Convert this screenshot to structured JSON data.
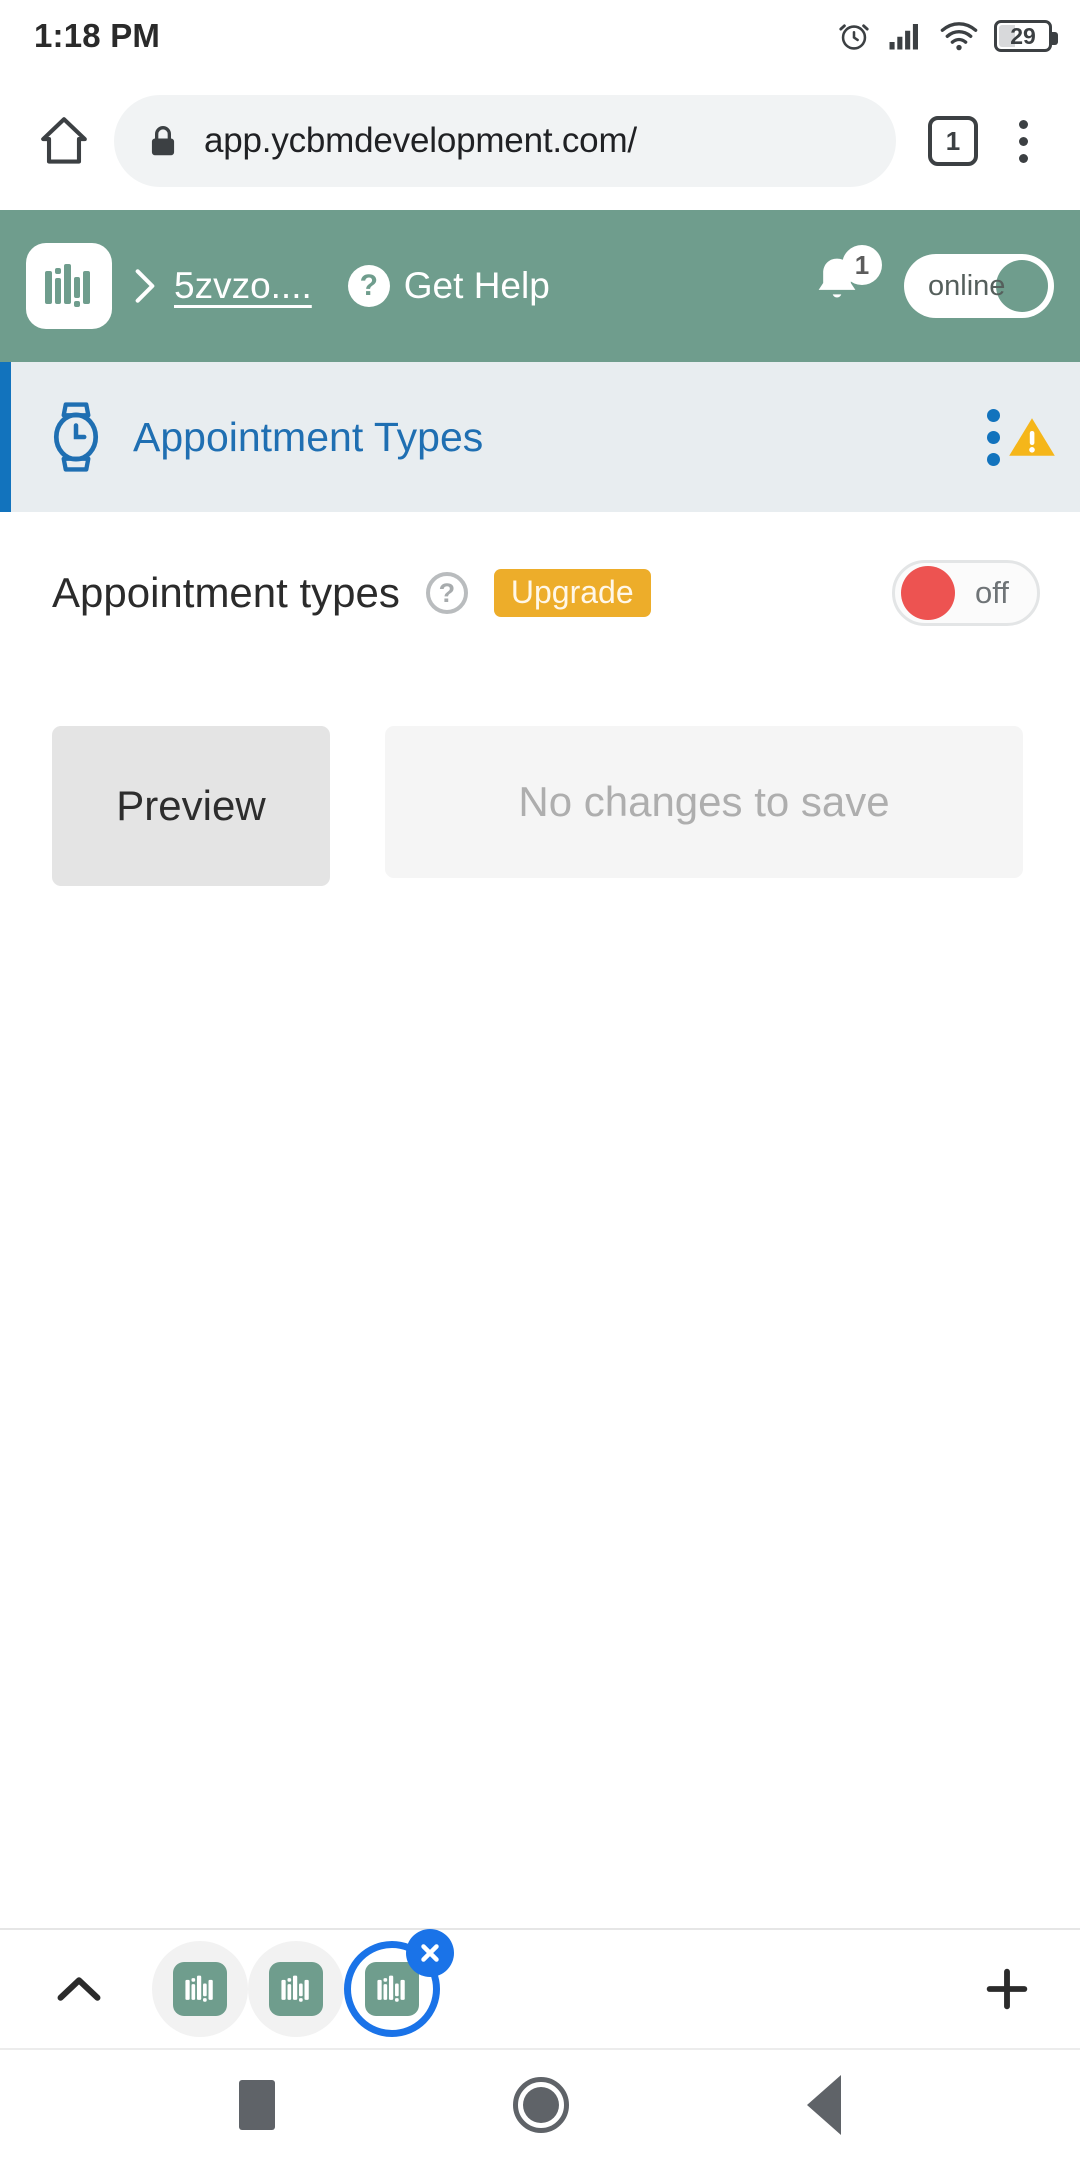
{
  "status_bar": {
    "time": "1:18 PM",
    "battery_percent": "29",
    "icons": [
      "alarm-icon",
      "signal-icon",
      "wifi-icon",
      "battery-icon"
    ]
  },
  "browser": {
    "home_icon": "home-icon",
    "lock_icon": "lock-icon",
    "url": "app.ycbmdevelopment.com/",
    "tab_count": "1",
    "menu_icon": "overflow-menu-icon"
  },
  "app_header": {
    "logo_icon": "ycbm-logo-icon",
    "breadcrumb_separator": "›",
    "breadcrumb": "5zvzo....",
    "help_icon": "question-mark-icon",
    "help_label": "Get Help",
    "bell_icon": "notification-bell-icon",
    "bell_badge": "1",
    "availability_label": "online",
    "background_color": "#6f9d8d"
  },
  "section_bar": {
    "icon": "watch-clock-icon",
    "title": "Appointment Types",
    "menu_icon": "vertical-dots-icon",
    "warning_icon": "warning-triangle-icon",
    "accent_color": "#1273bd",
    "background_color": "#e8edf0"
  },
  "main": {
    "setting_label": "Appointment types",
    "help_icon": "question-circle-icon",
    "upgrade_badge": "Upgrade",
    "upgrade_color": "#edad2a",
    "toggle_state_label": "off",
    "toggle_knob_color": "#ed5351",
    "preview_button": "Preview",
    "save_button": "No changes to save"
  },
  "tabstrip": {
    "collapse_icon": "chevron-up-icon",
    "tabs": [
      {
        "icon": "ycbm-tab-icon",
        "active": false
      },
      {
        "icon": "ycbm-tab-icon",
        "active": false
      },
      {
        "icon": "ycbm-tab-icon",
        "active": true,
        "close_icon": "close-x-icon"
      }
    ],
    "new_tab_icon": "plus-icon"
  },
  "nav_bar": {
    "recents_icon": "square-recents-icon",
    "home_icon": "circle-home-icon",
    "back_icon": "triangle-back-icon"
  }
}
